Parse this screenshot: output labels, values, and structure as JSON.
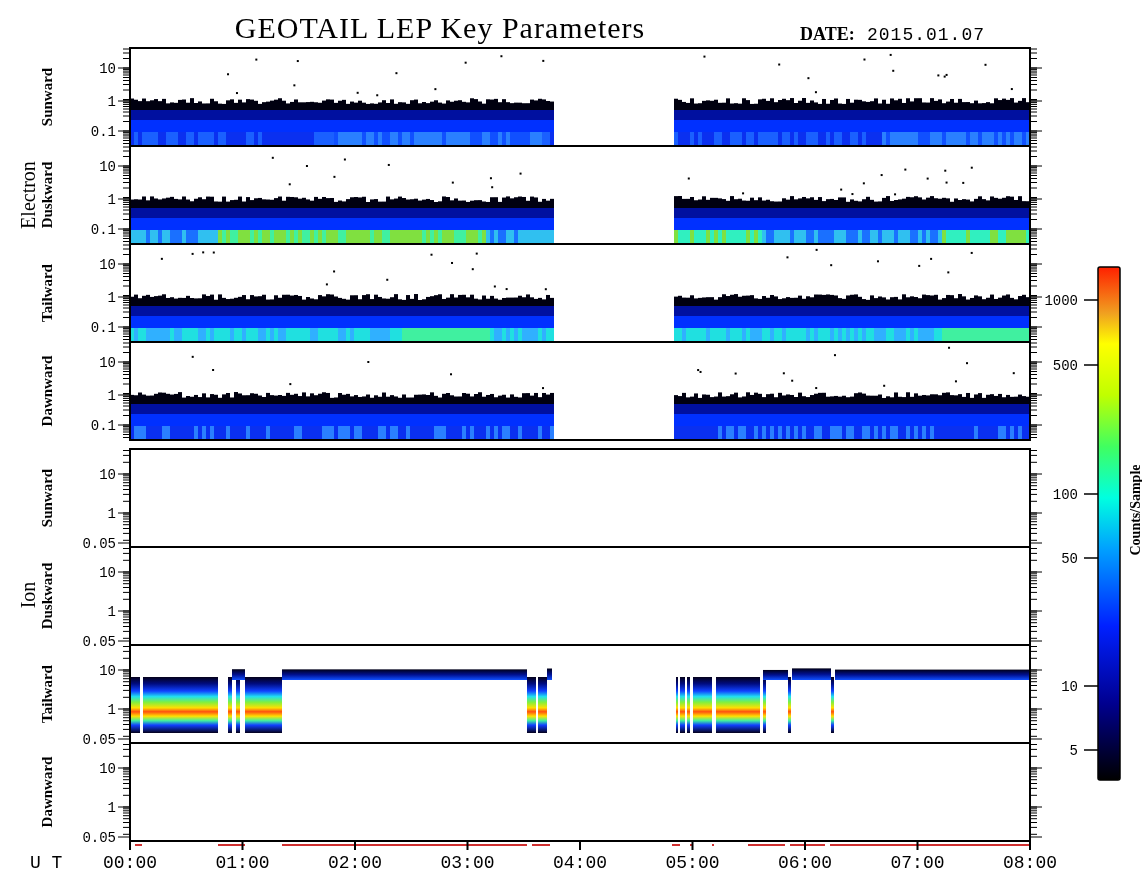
{
  "title": "GEOTAIL LEP Key Parameters",
  "date": {
    "label": "DATE:",
    "value": "2015.01.07"
  },
  "groups": [
    {
      "label": "Electron",
      "panels": [
        {
          "label": "Sunward",
          "yticks": [
            "10",
            "1",
            "0.1"
          ]
        },
        {
          "label": "Duskward",
          "yticks": [
            "10",
            "1",
            "0.1"
          ]
        },
        {
          "label": "Tailward",
          "yticks": [
            "10",
            "1",
            "0.1"
          ]
        },
        {
          "label": "Dawnward",
          "yticks": [
            "10",
            "1",
            "0.1"
          ]
        }
      ]
    },
    {
      "label": "Ion",
      "panels": [
        {
          "label": "Sunward",
          "yticks": [
            "10",
            "1",
            "0.05"
          ]
        },
        {
          "label": "Duskward",
          "yticks": [
            "10",
            "1",
            "0.05"
          ]
        },
        {
          "label": "Tailward",
          "yticks": [
            "10",
            "1",
            "0.05"
          ]
        },
        {
          "label": "Dawnward",
          "yticks": [
            "10",
            "1",
            "0.05"
          ]
        }
      ]
    }
  ],
  "x_axis": {
    "label": "U T",
    "ticks": [
      "00:00",
      "01:00",
      "02:00",
      "03:00",
      "04:00",
      "05:00",
      "06:00",
      "07:00",
      "08:00"
    ]
  },
  "colorbar": {
    "title": "Counts/Sample",
    "ticks": [
      "1000",
      "500",
      "100",
      "50",
      "10",
      "5"
    ]
  }
}
